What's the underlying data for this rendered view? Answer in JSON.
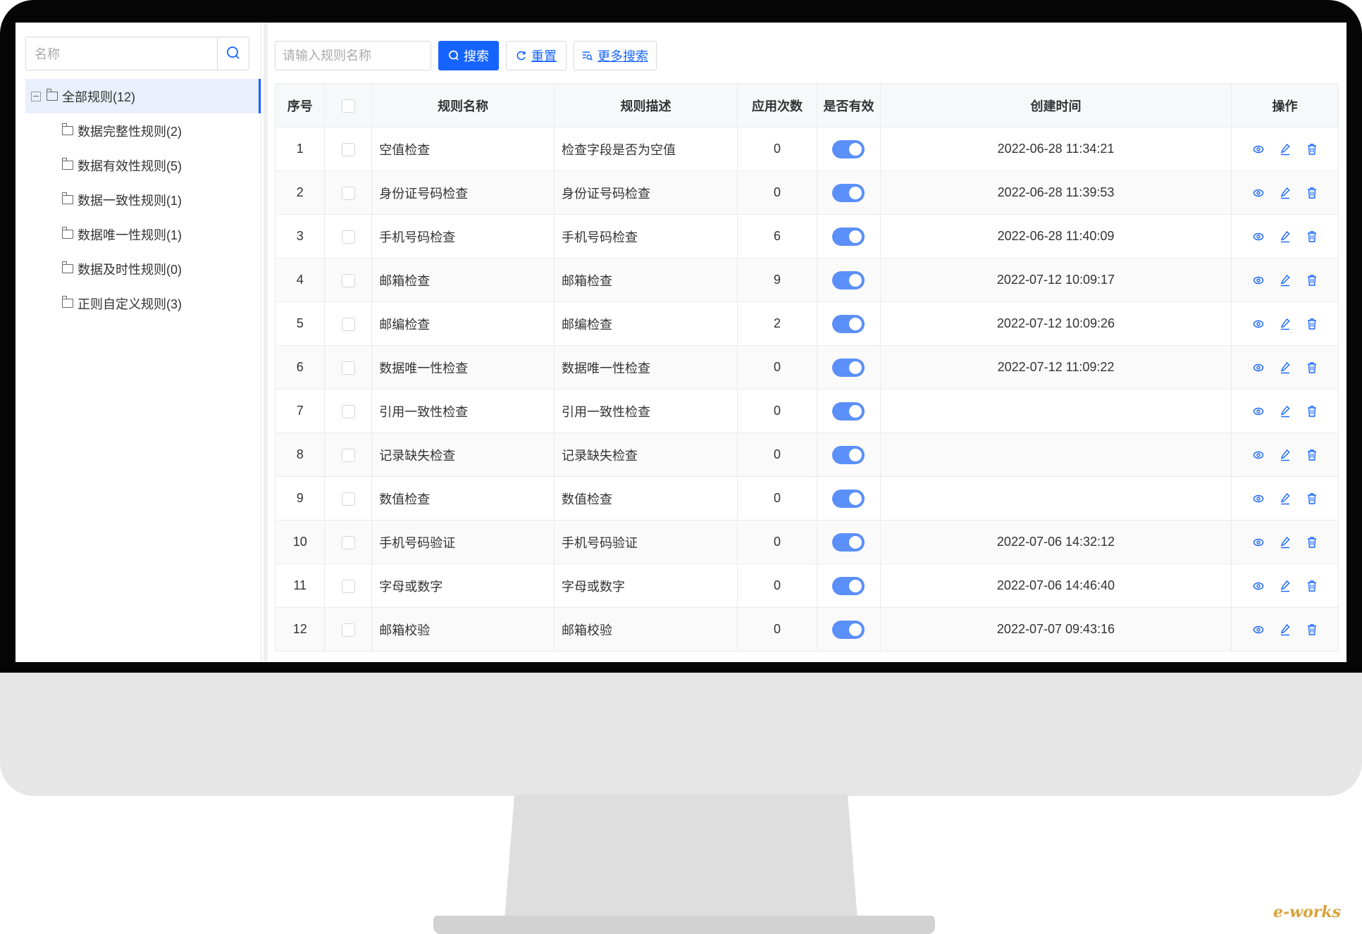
{
  "tree": {
    "search_placeholder": "名称",
    "root": {
      "label": "全部规则(12)"
    },
    "children": [
      {
        "label": "数据完整性规则(2)"
      },
      {
        "label": "数据有效性规则(5)"
      },
      {
        "label": "数据一致性规则(1)"
      },
      {
        "label": "数据唯一性规则(1)"
      },
      {
        "label": "数据及时性规则(0)"
      },
      {
        "label": "正则自定义规则(3)"
      }
    ]
  },
  "toolbar": {
    "search_placeholder": "请输入规则名称",
    "search_label": "搜索",
    "reset_label": "重置",
    "more_label": "更多搜索"
  },
  "table": {
    "columns": [
      "序号",
      "",
      "规则名称",
      "规则描述",
      "应用次数",
      "是否有效",
      "创建时间",
      "操作"
    ],
    "rows": [
      {
        "no": "1",
        "name": "空值检查",
        "desc": "检查字段是否为空值",
        "count": "0",
        "enabled": true,
        "created": "2022-06-28 11:34:21"
      },
      {
        "no": "2",
        "name": "身份证号码检查",
        "desc": "身份证号码检查",
        "count": "0",
        "enabled": true,
        "created": "2022-06-28 11:39:53"
      },
      {
        "no": "3",
        "name": "手机号码检查",
        "desc": "手机号码检查",
        "count": "6",
        "enabled": true,
        "created": "2022-06-28 11:40:09"
      },
      {
        "no": "4",
        "name": "邮箱检查",
        "desc": "邮箱检查",
        "count": "9",
        "enabled": true,
        "created": "2022-07-12 10:09:17"
      },
      {
        "no": "5",
        "name": "邮编检查",
        "desc": "邮编检查",
        "count": "2",
        "enabled": true,
        "created": "2022-07-12 10:09:26"
      },
      {
        "no": "6",
        "name": "数据唯一性检查",
        "desc": "数据唯一性检查",
        "count": "0",
        "enabled": true,
        "created": "2022-07-12 11:09:22"
      },
      {
        "no": "7",
        "name": "引用一致性检查",
        "desc": "引用一致性检查",
        "count": "0",
        "enabled": true,
        "created": ""
      },
      {
        "no": "8",
        "name": "记录缺失检查",
        "desc": "记录缺失检查",
        "count": "0",
        "enabled": true,
        "created": ""
      },
      {
        "no": "9",
        "name": "数值检查",
        "desc": "数值检查",
        "count": "0",
        "enabled": true,
        "created": ""
      },
      {
        "no": "10",
        "name": "手机号码验证",
        "desc": "手机号码验证",
        "count": "0",
        "enabled": true,
        "created": "2022-07-06 14:32:12"
      },
      {
        "no": "11",
        "name": "字母或数字",
        "desc": "字母或数字",
        "count": "0",
        "enabled": true,
        "created": "2022-07-06 14:46:40"
      },
      {
        "no": "12",
        "name": "邮箱校验",
        "desc": "邮箱校验",
        "count": "0",
        "enabled": true,
        "created": "2022-07-07 09:43:16"
      }
    ]
  },
  "watermark": "e-works",
  "colors": {
    "primary": "#1664ff",
    "switch_on": "#5b8ff9"
  }
}
